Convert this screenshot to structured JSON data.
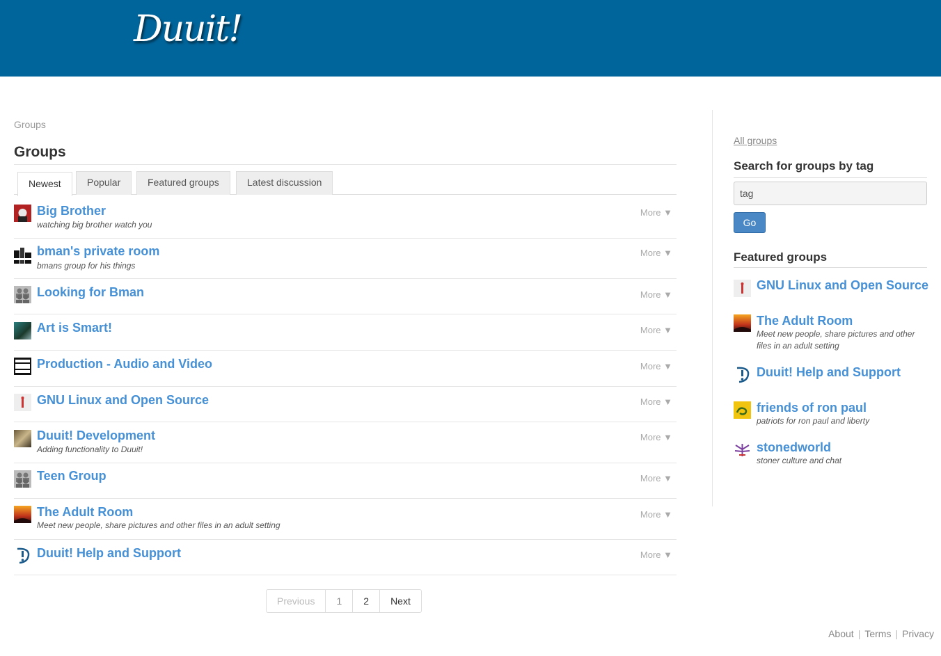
{
  "header": {
    "logo_text": "Duuit!"
  },
  "breadcrumb": "Groups",
  "page_title": "Groups",
  "tabs": [
    {
      "label": "Newest",
      "active": true
    },
    {
      "label": "Popular",
      "active": false
    },
    {
      "label": "Featured groups",
      "active": false
    },
    {
      "label": "Latest discussion",
      "active": false
    }
  ],
  "groups": [
    {
      "name": "Big Brother",
      "desc": "watching big brother watch you",
      "more": "More ▼",
      "icon": "vampire-avatar-icon"
    },
    {
      "name": "bman's private room",
      "desc": "bmans group for his things",
      "more": "More ▼",
      "icon": "skyline-avatar-icon"
    },
    {
      "name": "Looking for Bman",
      "desc": "",
      "more": "More ▼",
      "icon": "default-group-icon"
    },
    {
      "name": "Art is Smart!",
      "desc": "",
      "more": "More ▼",
      "icon": "art-avatar-icon"
    },
    {
      "name": "Production - Audio and Video",
      "desc": "",
      "more": "More ▼",
      "icon": "advisory-avatar-icon"
    },
    {
      "name": "GNU Linux and Open Source",
      "desc": "",
      "more": "More ▼",
      "icon": "gnu-avatar-icon"
    },
    {
      "name": "Duuit! Development",
      "desc": "Adding functionality to Duuit!",
      "more": "More ▼",
      "icon": "dev-avatar-icon"
    },
    {
      "name": "Teen Group",
      "desc": "",
      "more": "More ▼",
      "icon": "default-group-icon"
    },
    {
      "name": "The Adult Room",
      "desc": "Meet new people, share pictures and other files in an adult setting",
      "more": "More ▼",
      "icon": "sunset-avatar-icon"
    },
    {
      "name": "Duuit! Help and Support",
      "desc": "",
      "more": "More ▼",
      "icon": "duuit-logo-icon"
    }
  ],
  "pagination": {
    "previous": "Previous",
    "pages": [
      "1",
      "2"
    ],
    "next": "Next"
  },
  "sidebar": {
    "all_groups": "All groups",
    "search_heading": "Search for groups by tag",
    "search_value": "tag",
    "go_label": "Go",
    "featured_heading": "Featured groups",
    "featured": [
      {
        "name": "GNU Linux and Open Source",
        "desc": "",
        "icon": "gnu-avatar-icon"
      },
      {
        "name": "The Adult Room",
        "desc": "Meet new people, share pictures and other files in an adult setting",
        "icon": "sunset-avatar-icon"
      },
      {
        "name": "Duuit! Help and Support",
        "desc": "",
        "icon": "duuit-logo-icon"
      },
      {
        "name": "friends of ron paul",
        "desc": "patriots for ron paul and liberty",
        "icon": "gadsden-flag-icon"
      },
      {
        "name": "stonedworld",
        "desc": "stoner culture and chat",
        "icon": "leaf-avatar-icon"
      }
    ]
  },
  "footer": {
    "about": "About",
    "terms": "Terms",
    "privacy": "Privacy"
  },
  "colors": {
    "topbar": "#00659b",
    "link": "#4690d6",
    "button": "#4a88c5"
  }
}
